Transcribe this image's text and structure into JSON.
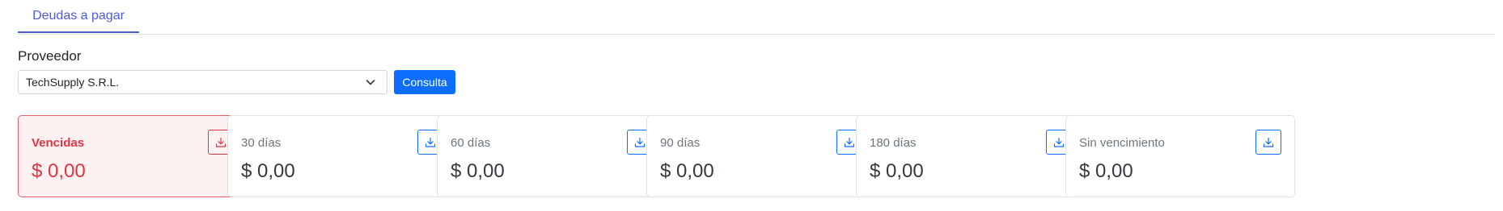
{
  "tabs": {
    "active_label": "Deudas a pagar"
  },
  "form": {
    "provider_label": "Proveedor",
    "provider_value": "TechSupply S.R.L.",
    "submit_label": "Consulta"
  },
  "cards": [
    {
      "title": "Vencidas",
      "amount": "$ 0,00",
      "variant": "danger"
    },
    {
      "title": "30 días",
      "amount": "$ 0,00",
      "variant": "default"
    },
    {
      "title": "60 días",
      "amount": "$ 0,00",
      "variant": "default"
    },
    {
      "title": "90 días",
      "amount": "$ 0,00",
      "variant": "default"
    },
    {
      "title": "180 días",
      "amount": "$ 0,00",
      "variant": "default"
    },
    {
      "title": "Sin vencimiento",
      "amount": "$ 0,00",
      "variant": "default"
    }
  ],
  "colors": {
    "primary": "#0d6efd",
    "danger": "#dc3545",
    "tab_accent": "#4d5bd6"
  },
  "icons": {
    "download": "download-icon",
    "chevron": "chevron-down-icon"
  }
}
